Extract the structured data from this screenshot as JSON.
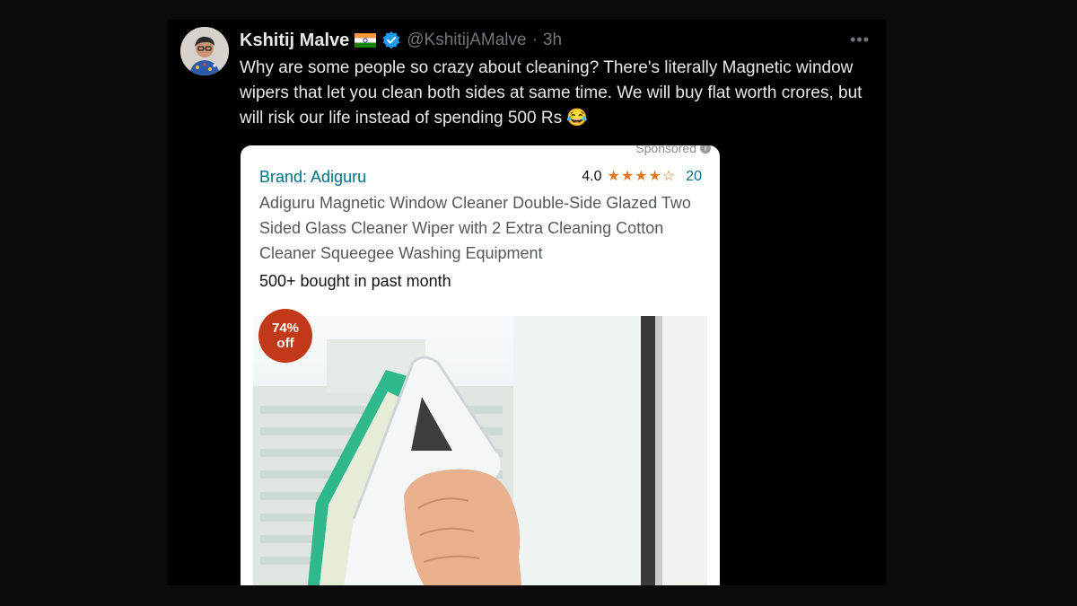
{
  "tweet": {
    "author_name": "Kshitij Malve",
    "handle": "@KshitijAMalve",
    "separator": "·",
    "time": "3h",
    "more_label": "•••",
    "text": "Why are some people so crazy about cleaning? There's literally Magnetic window wipers that let you clean both sides at same time. We will buy flat worth crores, but will risk our life instead of spending 500 Rs 😂"
  },
  "ad": {
    "sponsored_label": "Sponsored",
    "brand": "Brand: Adiguru",
    "rating_value": "4.0",
    "rating_stars": 4,
    "rating_max": 5,
    "rating_count": "20",
    "product_title": "Adiguru Magnetic Window Cleaner Double-Side Glazed Two Sided Glass Cleaner Wiper with 2 Extra Cleaning Cotton Cleaner Squeegee Washing Equipment",
    "bought_text": "500+ bought in past month",
    "discount_percent": "74%",
    "discount_word": "off"
  },
  "icons": [
    "india-flag-icon",
    "verified-badge-icon",
    "more-options-icon",
    "info-icon",
    "star-icon"
  ],
  "colors": {
    "background": "#000000",
    "text_primary": "#e7e9ea",
    "text_secondary": "#71767b",
    "verified_blue": "#1d9bf0",
    "amazon_link": "#007185",
    "star": "#de7921",
    "badge": "#c2391a"
  }
}
